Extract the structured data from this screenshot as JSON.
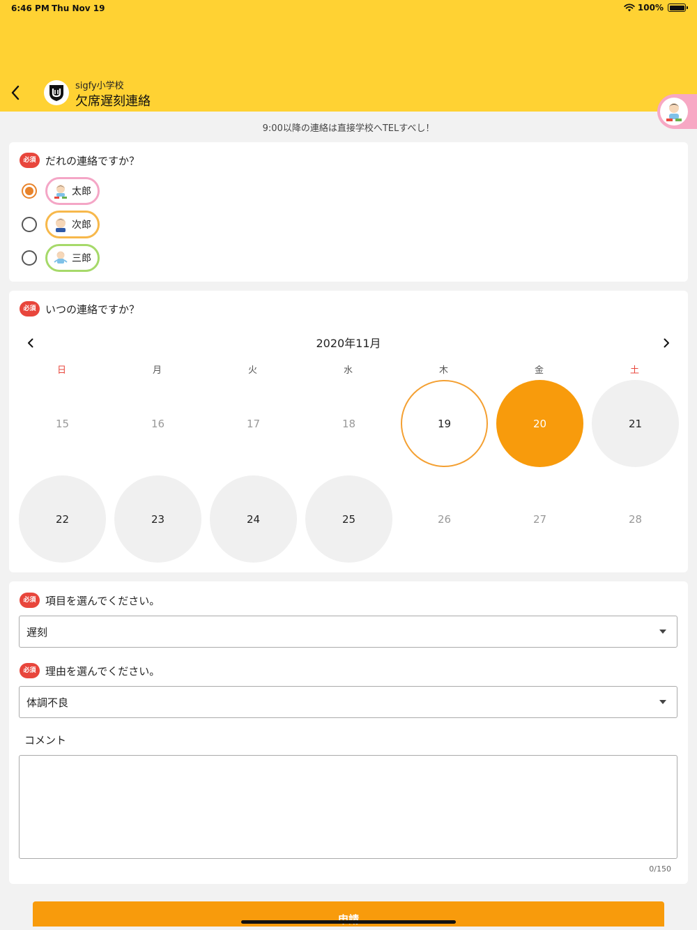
{
  "status_bar": {
    "time": "6:46 PM",
    "date": "Thu Nov 19",
    "battery": "100%"
  },
  "header": {
    "school_name": "sigfy小学校",
    "title": "欠席遅刻連絡"
  },
  "notice": "9:00以降の連絡は直接学校へTELすべし！",
  "required_badge": "必須",
  "who": {
    "question": "だれの連絡ですか？",
    "children": [
      {
        "name": "太郎",
        "selected": true,
        "color": "#f4a6c6"
      },
      {
        "name": "次郎",
        "selected": false,
        "color": "#f7b84b"
      },
      {
        "name": "三郎",
        "selected": false,
        "color": "#a6d96a"
      }
    ]
  },
  "when": {
    "question": "いつの連絡ですか？",
    "month_label": "2020年11月",
    "weekdays": [
      "日",
      "月",
      "火",
      "水",
      "木",
      "金",
      "土"
    ],
    "weekday_colors": {
      "sunday": "#e8463c",
      "saturday": "#e8463c"
    },
    "weeks": [
      [
        {
          "day": "15",
          "state": "disabled"
        },
        {
          "day": "16",
          "state": "disabled"
        },
        {
          "day": "17",
          "state": "disabled"
        },
        {
          "day": "18",
          "state": "disabled"
        },
        {
          "day": "19",
          "state": "today"
        },
        {
          "day": "20",
          "state": "selected"
        },
        {
          "day": "21",
          "state": "available"
        }
      ],
      [
        {
          "day": "22",
          "state": "available"
        },
        {
          "day": "23",
          "state": "available"
        },
        {
          "day": "24",
          "state": "available"
        },
        {
          "day": "25",
          "state": "available"
        },
        {
          "day": "26",
          "state": "disabled"
        },
        {
          "day": "27",
          "state": "disabled"
        },
        {
          "day": "28",
          "state": "disabled"
        }
      ]
    ]
  },
  "details": {
    "item_question": "項目を選んでください。",
    "item_value": "遅刻",
    "reason_question": "理由を選んでください。",
    "reason_value": "体調不良",
    "comment_label": "コメント",
    "comment_value": "",
    "counter": "0/150"
  },
  "submit_label": "申請",
  "colors": {
    "header": "#ffd233",
    "accent": "#f89b0c",
    "required": "#e8463c"
  }
}
